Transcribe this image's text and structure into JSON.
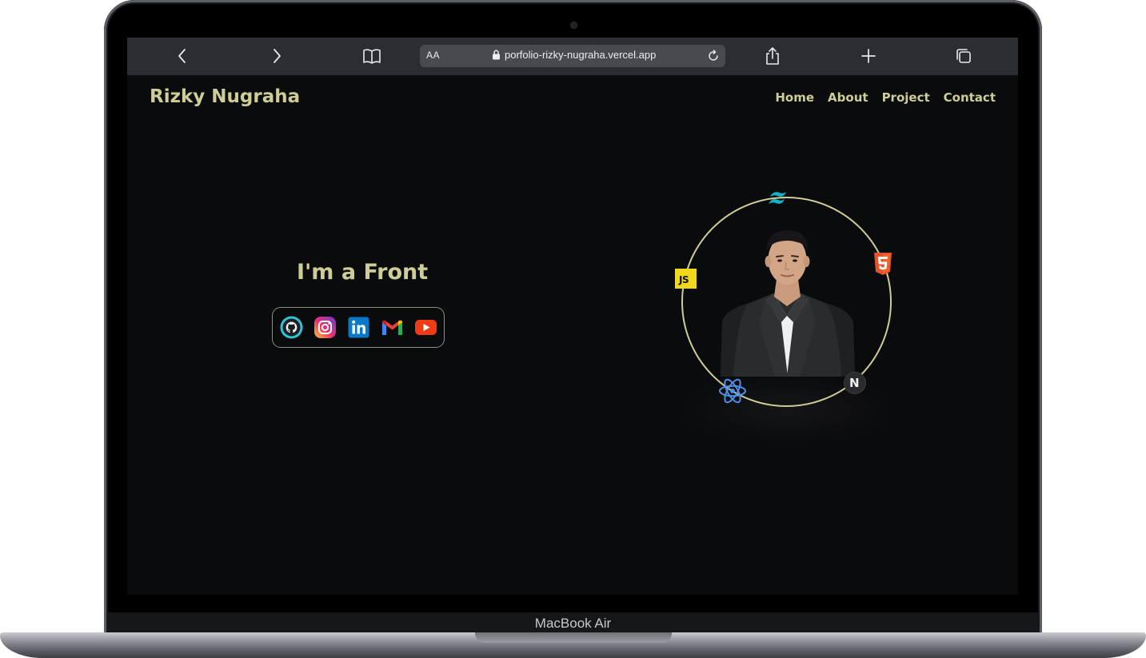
{
  "device": {
    "label": "MacBook Air"
  },
  "browser": {
    "text_size_button": "AA",
    "url": "porfolio-rizky-nugraha.vercel.app",
    "icons": [
      "back-icon",
      "forward-icon",
      "bookmarks-icon",
      "lock-icon",
      "reload-icon",
      "share-icon",
      "new-tab-icon",
      "tabs-icon"
    ]
  },
  "site": {
    "brand": "Rizky Nugraha",
    "nav": [
      "Home",
      "About",
      "Project",
      "Contact"
    ],
    "hero": {
      "headline": "I'm a Front",
      "socials": [
        "github-icon",
        "instagram-icon",
        "linkedin-icon",
        "gmail-icon",
        "youtube-icon"
      ]
    },
    "orbit": {
      "photo": "profile-photo",
      "tech_icons": [
        "tailwind-icon",
        "html5-icon",
        "javascript-icon",
        "react-icon",
        "nextjs-icon"
      ],
      "js_label": "JS",
      "next_label": "N"
    }
  },
  "colors": {
    "accent": "#cfcd96",
    "page_background": "#0a0b0d",
    "toolbar": "#2a2d31",
    "url_field": "#474b50"
  }
}
